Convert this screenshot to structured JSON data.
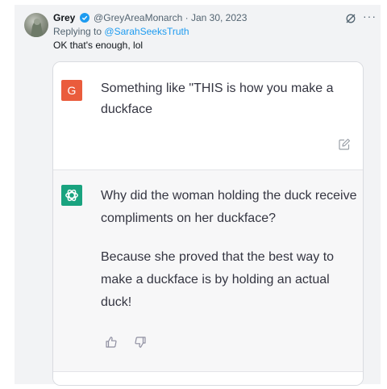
{
  "tweet": {
    "author_name": "Grey",
    "handle": "@GreyAreaMonarch",
    "separator": "·",
    "date": "Jan 30, 2023",
    "replying_prefix": "Replying to",
    "replying_to": "@SarahSeeksTruth",
    "text": "OK that's enough, lol",
    "more_label": "···",
    "icons": {
      "verified": "verified-badge-icon",
      "grok": "grok-icon",
      "more": "more-icon"
    },
    "colors": {
      "link": "#1d9bf0",
      "verified": "#1d9bf0",
      "text": "#0f1419",
      "muted": "#536471"
    }
  },
  "chat": {
    "user_avatar_letter": "G",
    "user_prompt": "Something like \"THIS is how you make a duckface",
    "assistant_paragraphs": [
      "Why did the woman holding the duck receive compliments on her duckface?",
      "Because she proved that the best way to make a duckface is by holding an actual duck!"
    ],
    "icons": {
      "edit": "edit-icon",
      "assistant_avatar": "chatgpt-logo-icon",
      "like": "thumbs-up-icon",
      "dislike": "thumbs-down-icon"
    },
    "colors": {
      "user_avatar": "#ea5c3c",
      "assistant_avatar": "#19a37f",
      "assistant_bg": "#f7f7f8",
      "text": "#343541"
    }
  }
}
